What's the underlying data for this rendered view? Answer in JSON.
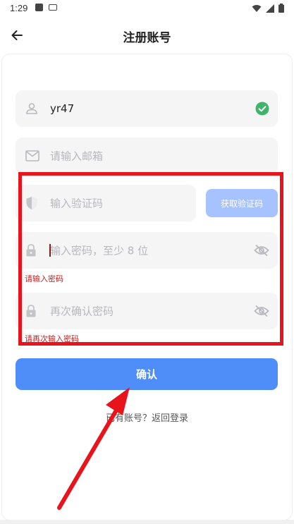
{
  "status_bar": {
    "time": "1:29"
  },
  "header": {
    "title": "注册账号"
  },
  "form": {
    "username": {
      "value": "yr47"
    },
    "email": {
      "placeholder": "请输入邮箱"
    },
    "verify_code": {
      "placeholder": "输入验证码",
      "button_label": "获取验证码"
    },
    "password": {
      "placeholder": "输入密码，至少 8 位",
      "error": "请输入密码"
    },
    "confirm_password": {
      "placeholder": "再次确认密码",
      "error": "请再次输入密码"
    }
  },
  "actions": {
    "confirm_label": "确认",
    "login_link": "已有账号？返回登录"
  },
  "colors": {
    "primary": "#4f8ef8",
    "primary_disabled": "#a7c3ff",
    "error": "#c81d1d",
    "success": "#3fb46b",
    "highlight": "#e8141c"
  }
}
